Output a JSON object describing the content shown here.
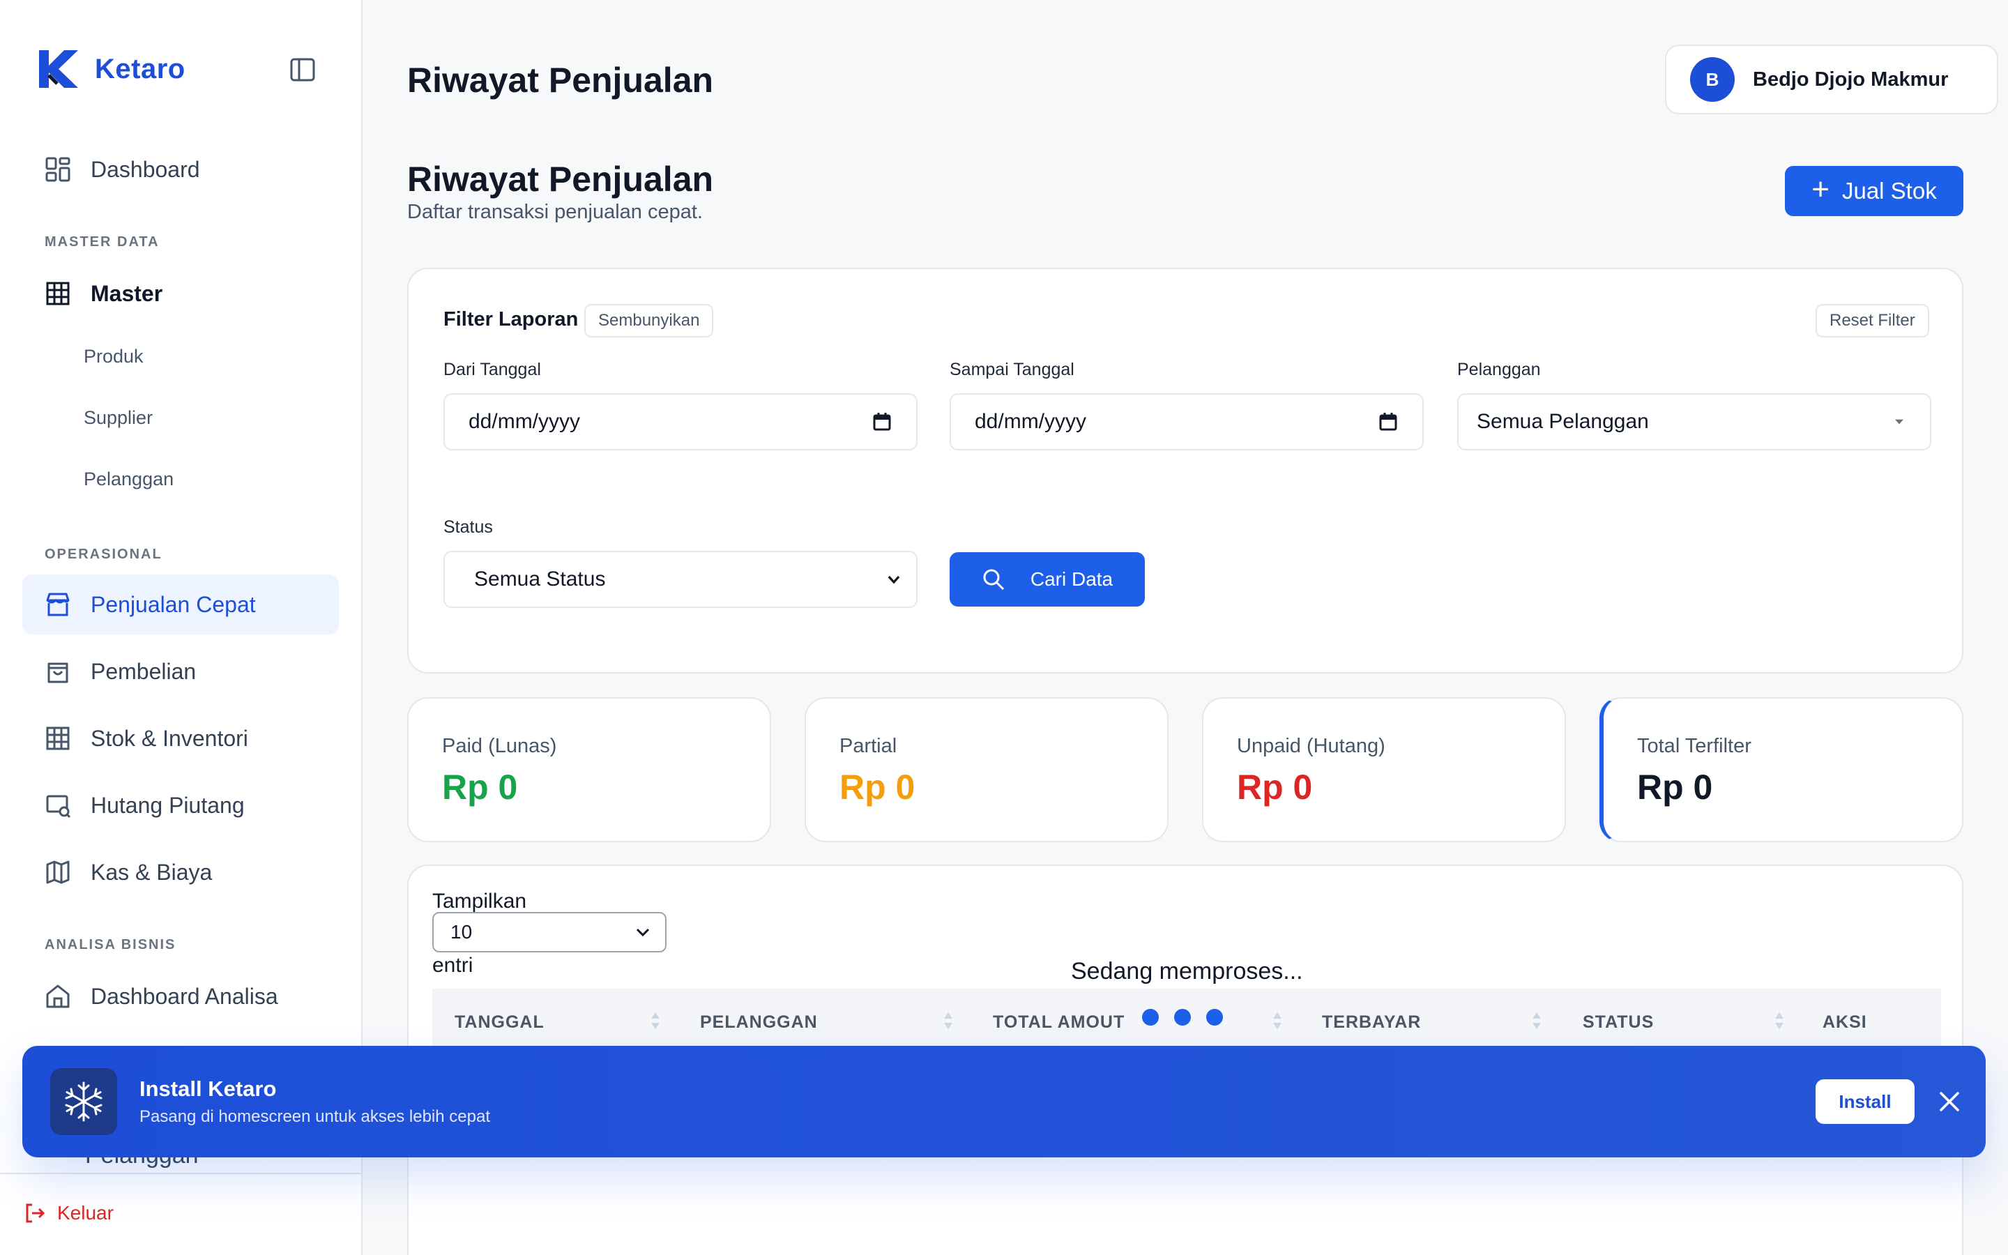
{
  "brand": {
    "name": "Ketaro"
  },
  "user": {
    "initial": "B",
    "name": "Bedjo Djojo Makmur"
  },
  "sidebar": {
    "dashboard": "Dashboard",
    "section_master": "MASTER DATA",
    "master": "Master",
    "master_items": [
      "Produk",
      "Supplier",
      "Pelanggan"
    ],
    "section_operasional": "OPERASIONAL",
    "operasional_items": [
      "Penjualan Cepat",
      "Pembelian",
      "Stok & Inventori",
      "Hutang Piutang",
      "Kas & Biaya"
    ],
    "section_analisa": "ANALISA BISNIS",
    "analisa_items": [
      "Dashboard Analisa"
    ],
    "partial_item": "Pelanggan",
    "logout": "Keluar"
  },
  "header": {
    "title": "Riwayat Penjualan"
  },
  "page": {
    "title": "Riwayat Penjualan",
    "subtitle": "Daftar transaksi penjualan cepat.",
    "primary_action": "Jual Stok"
  },
  "filter": {
    "title": "Filter Laporan",
    "hide": "Sembunyikan",
    "reset": "Reset Filter",
    "from_label": "Dari Tanggal",
    "from_value": "dd/mm/yyyy",
    "to_label": "Sampai Tanggal",
    "to_value": "dd/mm/yyyy",
    "customer_label": "Pelanggan",
    "customer_value": "Semua Pelanggan",
    "status_label": "Status",
    "status_value": "Semua Status",
    "search": "Cari Data"
  },
  "stats": [
    {
      "label": "Paid (Lunas)",
      "value": "Rp 0",
      "color": "#16a34a"
    },
    {
      "label": "Partial",
      "value": "Rp 0",
      "color": "#f59e0b"
    },
    {
      "label": "Unpaid (Hutang)",
      "value": "Rp 0",
      "color": "#dc2626"
    },
    {
      "label": "Total Terfilter",
      "value": "Rp 0",
      "color": "#111827"
    }
  ],
  "table": {
    "show_label": "Tampilkan",
    "length_value": "10",
    "entries_label": "entri",
    "processing": "Sedang memproses...",
    "columns": [
      "TANGGAL",
      "PELANGGAN",
      "TOTAL AMOUT",
      "TERBAYAR",
      "STATUS",
      "AKSI"
    ]
  },
  "install_banner": {
    "title": "Install Ketaro",
    "subtitle": "Pasang di homescreen untuk akses lebih cepat",
    "button": "Install"
  },
  "colors": {
    "accent": "#1d5fe8",
    "brand": "#1d4ed8"
  }
}
